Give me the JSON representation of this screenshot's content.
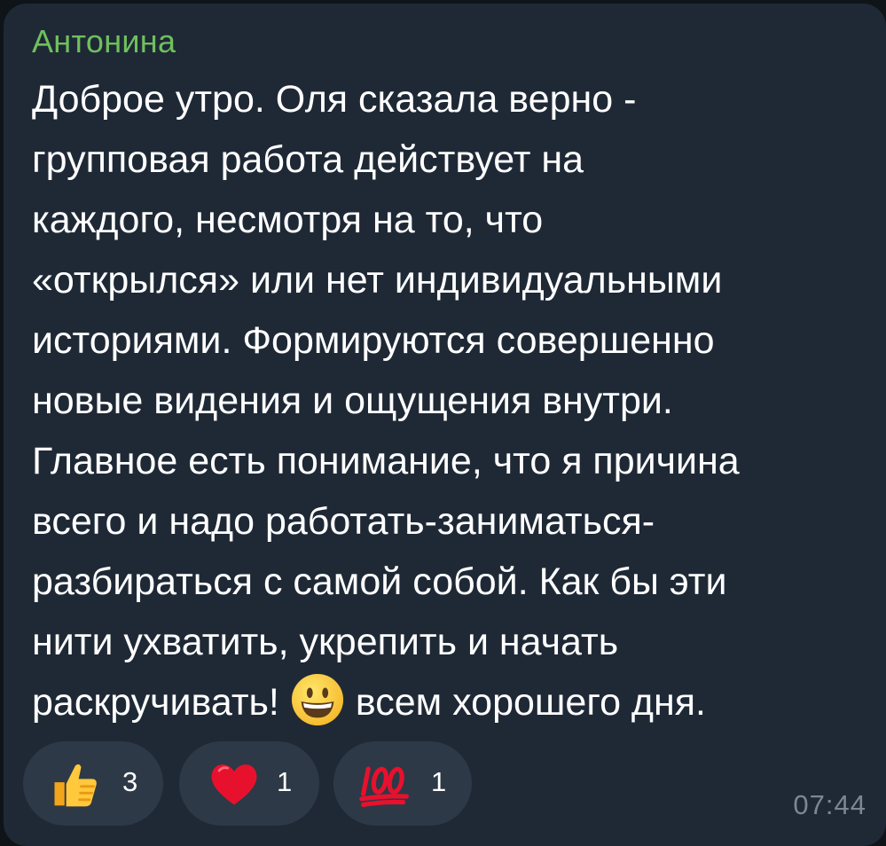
{
  "message": {
    "sender": "Антонина",
    "lines": [
      "Доброе утро. Оля сказала верно -",
      "групповая работа действует на",
      "каждого, несмотря на то, что",
      "«открылся» или нет индивидуальными",
      "историями. Формируются совершенно",
      "новые видения и ощущения внутри.",
      "Главное есть понимание, что я причина",
      "всего и надо работать-заниматься-",
      "разбираться с самой собой. Как бы эти",
      "нити ухватить, укрепить и начать"
    ],
    "last_line_before_emoji": "раскручивать!",
    "inline_emoji": "grinning-face-emoji",
    "last_line_after_emoji": "всем хорошего дня.",
    "time": "07:44"
  },
  "reactions": [
    {
      "emoji": "thumbs-up-icon",
      "count": "3"
    },
    {
      "emoji": "red-heart-icon",
      "count": "1"
    },
    {
      "emoji": "hundred-points-icon",
      "count": "1"
    }
  ],
  "colors": {
    "bubble": "#1f2936",
    "sender": "#6fc05d",
    "text": "#ffffff",
    "reaction_pill": "#2d3947",
    "time": "#7b8794"
  }
}
